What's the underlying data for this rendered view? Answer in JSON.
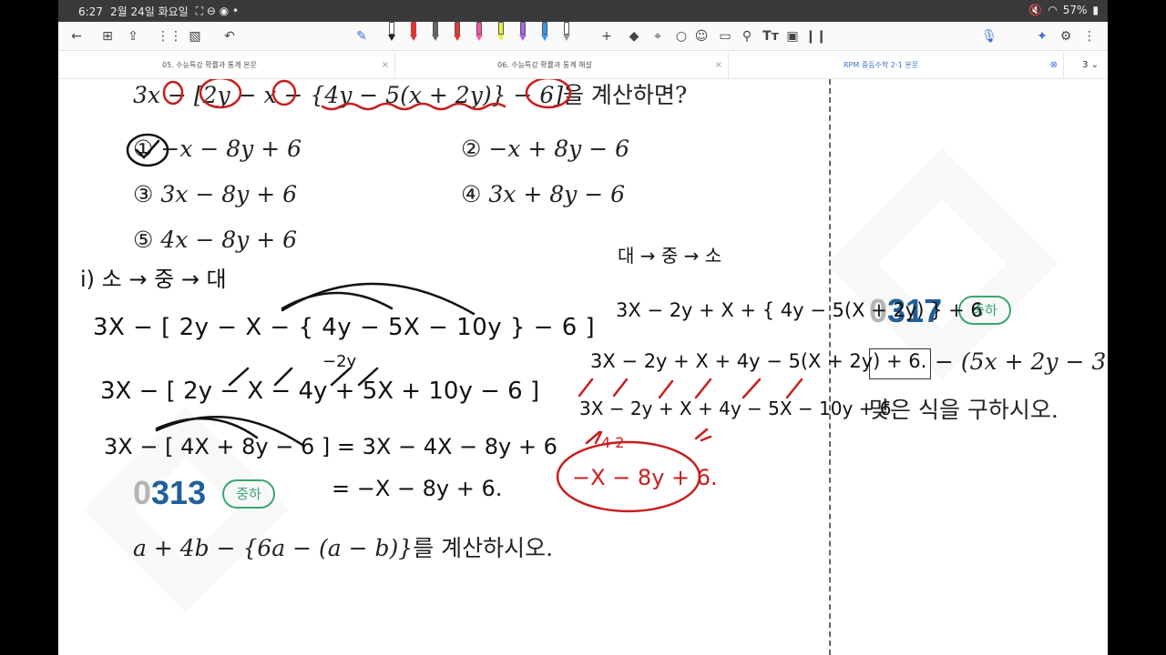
{
  "status_bar": {
    "time": "6:27",
    "date": "2월 24일 화요일",
    "battery": "57%"
  },
  "icons": {
    "back": "back-arrow-icon",
    "grid": "grid-icon",
    "share": "share-icon",
    "apps": "apps-icon",
    "undo": "undo-icon",
    "pen": "pen-icon",
    "add": "plus-icon",
    "eraser": "eraser-icon",
    "lasso": "lasso-icon",
    "mic": "mic-icon",
    "more": "more-icon"
  },
  "tabs": [
    {
      "label": "05. 수능특강 확률과 통계 본문"
    },
    {
      "label": "06. 수능특강 확률과 통계 해설"
    },
    {
      "label": "RPM 중등수학 2-1 본문"
    }
  ],
  "tab_count": "3",
  "problem": {
    "expression": "3x − [2y − x − {4y − 5(x + 2y)} − 6]",
    "suffix": "을 계산하면?",
    "choices": [
      {
        "num": "①",
        "text": "−x − 8y + 6"
      },
      {
        "num": "②",
        "text": "−x + 8y − 6"
      },
      {
        "num": "③",
        "text": "3x − 8y + 6"
      },
      {
        "num": "④",
        "text": "3x + 8y − 6"
      },
      {
        "num": "⑤",
        "text": "4x − 8y + 6"
      }
    ]
  },
  "q0313": {
    "zero": "0",
    "num": "313",
    "badge": "중하",
    "text_math": "a + 4b − {6a − (a − b)}",
    "text_suffix": "를 계산하시오."
  },
  "q0317": {
    "zero": "0",
    "num": "317",
    "badge": "중하",
    "text_math": "− (5x + 2y − 3",
    "text_suffix": "맞은 식을 구하시오."
  },
  "handwriting": {
    "left": [
      "i) 소 → 중 → 대",
      "3X − [ 2y − X − { 4y − 5X − 10y } − 6 ]",
      "−2y",
      "3X − [ 2y − X − 4y + 5X + 10y − 6 ]",
      "3X − [ 4X + 8y − 6 ] = 3X − 4X − 8y + 6",
      "= −X − 8y + 6."
    ],
    "right": [
      "대 → 중 → 소",
      "3X − 2y + X + { 4y − 5(X + 2y) } + 6",
      "3X − 2y + X + 4y − 5(X + 2y) + 6.",
      "3X − 2y + X + 4y − 5X − 10y + 6",
      "4   2",
      "−X − 8y + 6."
    ]
  },
  "colors": {
    "ink": "#111111",
    "red_ink": "#c81e1e",
    "accent_blue": "#1f5f9a",
    "badge_green": "#3aa66e"
  }
}
